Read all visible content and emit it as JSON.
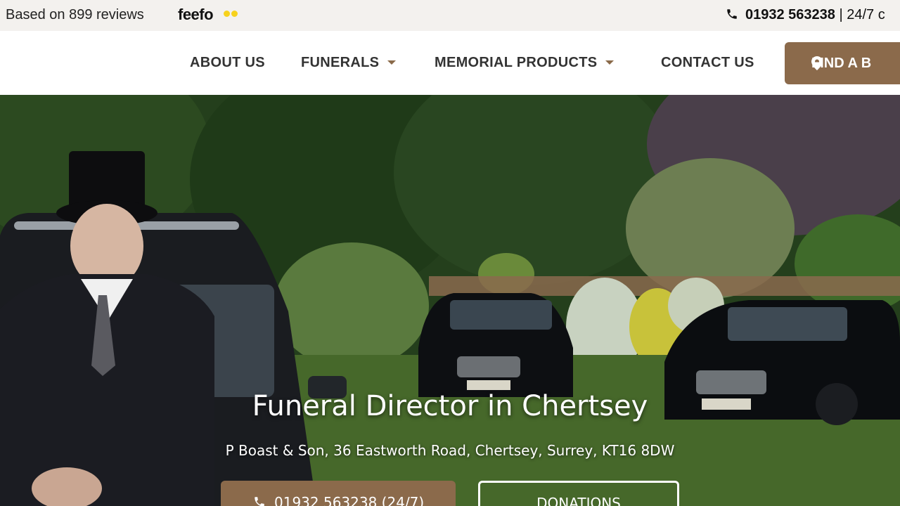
{
  "topbar": {
    "reviews_text": "Based on 899 reviews",
    "feefo_logo": "feefo",
    "phone_number": "01932 563238",
    "phone_suffix": "| 24/7 c"
  },
  "nav": {
    "items": [
      {
        "label": "ABOUT US"
      },
      {
        "label": "FUNERALS"
      },
      {
        "label": "MEMORIAL PRODUCTS"
      },
      {
        "label": "CONTACT US"
      }
    ],
    "find_button": "FIND A B"
  },
  "hero": {
    "title": "Funeral Director in Chertsey",
    "address": "P Boast & Son, 36 Eastworth Road, Chertsey, Surrey, KT16 8DW",
    "call_button": "01932 563238 (24/7)",
    "donate_button": "DONATIONS"
  },
  "colors": {
    "accent": "#8b6a4b",
    "topbar_bg": "#f3f1ee"
  },
  "icons": [
    "phone-icon",
    "chevron-down-icon",
    "map-pin-icon"
  ]
}
